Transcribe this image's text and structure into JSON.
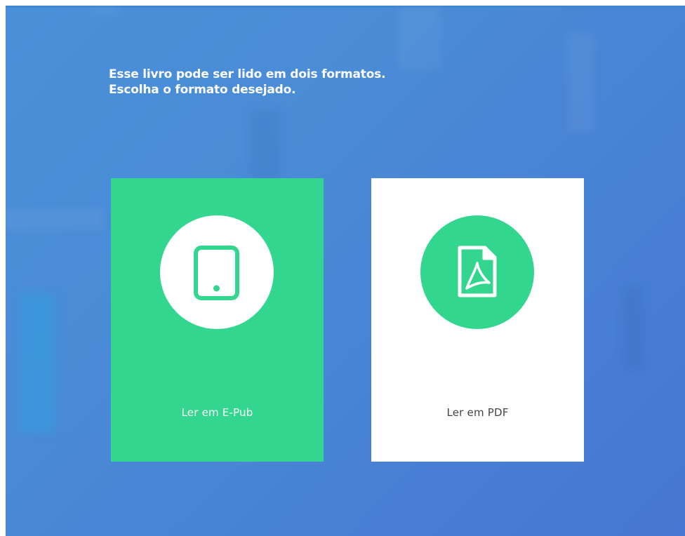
{
  "prompt": {
    "line1": "Esse livro pode ser lido em dois formatos.",
    "line2": "Escolha o formato desejado."
  },
  "options": [
    {
      "id": "epub",
      "label": "Ler em E-Pub",
      "icon": "tablet-icon",
      "selected": true
    },
    {
      "id": "pdf",
      "label": "Ler em PDF",
      "icon": "pdf-file-icon",
      "selected": false
    }
  ],
  "colors": {
    "background": "#4a88d6",
    "accent_green": "#33d68e",
    "card_white": "#ffffff",
    "heading_text": "#ffffff",
    "pdf_label_text": "#444444"
  }
}
